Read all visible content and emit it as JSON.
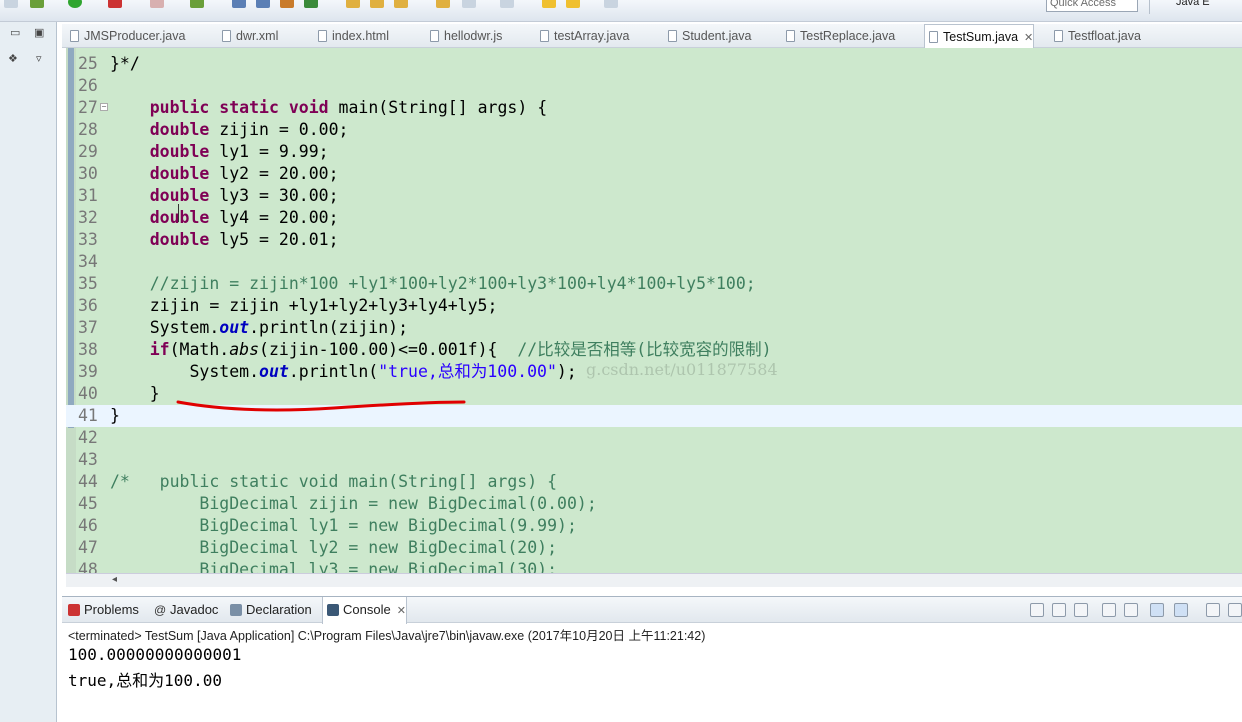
{
  "quick_access": "Quick Access",
  "perspective": "Java E",
  "editor_tabs": [
    "JMSProducer.java",
    "dwr.xml",
    "index.html",
    "hellodwr.js",
    "testArray.java",
    "Student.java",
    "TestReplace.java",
    "TestSum.java",
    "Testfloat.java"
  ],
  "active_tab_close": "✕",
  "code_lines": [
    {
      "n": "25",
      "html": "}*/"
    },
    {
      "n": "26",
      "html": ""
    },
    {
      "n": "27",
      "html": "    <span class=\"k\">public</span> <span class=\"k\">static</span> <span class=\"k\">void</span> main(String[] args) {"
    },
    {
      "n": "28",
      "html": "    <span class=\"k\">double</span> zijin = 0.00;"
    },
    {
      "n": "29",
      "html": "    <span class=\"k\">double</span> ly1 = 9.99;"
    },
    {
      "n": "30",
      "html": "    <span class=\"k\">double</span> ly2 = 20.00;"
    },
    {
      "n": "31",
      "html": "    <span class=\"k\">double</span> ly3 = 30.00;"
    },
    {
      "n": "32",
      "html": "    <span class=\"k\">double</span> ly4 = 20.00;"
    },
    {
      "n": "33",
      "html": "    <span class=\"k\">double</span> ly5 = 20.01;"
    },
    {
      "n": "34",
      "html": ""
    },
    {
      "n": "35",
      "html": "    <span class=\"cm\">//zijin = zijin*100 +ly1*100+ly2*100+ly3*100+ly4*100+ly5*100;</span>"
    },
    {
      "n": "36",
      "html": "    zijin = zijin +ly1+ly2+ly3+ly4+ly5;"
    },
    {
      "n": "37",
      "html": "    System.<span class=\"fld\">out</span>.println(zijin);"
    },
    {
      "n": "38",
      "html": "    <span class=\"k\">if</span>(Math.<span class=\"it\">abs</span>(zijin-100.00)<=0.001f){  <span class=\"cm\">//比较是否相等(比较宽容的限制)</span>"
    },
    {
      "n": "39",
      "html": "        System.<span class=\"fld\">out</span>.println(<span class=\"st\">\"true,总和为100.00\"</span>);"
    },
    {
      "n": "40",
      "html": "    }"
    },
    {
      "n": "41",
      "html": "}"
    },
    {
      "n": "42",
      "html": ""
    },
    {
      "n": "43",
      "html": ""
    },
    {
      "n": "44",
      "html": "<span class=\"cm\">/*   public static void main(String[] args) {</span>"
    },
    {
      "n": "45",
      "html": "<span class=\"cm\">         BigDecimal zijin = new BigDecimal(0.00);</span>"
    },
    {
      "n": "46",
      "html": "<span class=\"cm\">         BigDecimal ly1 = new BigDecimal(9.99);</span>"
    },
    {
      "n": "47",
      "html": "<span class=\"cm\">         BigDecimal ly2 = new BigDecimal(20);</span>"
    },
    {
      "n": "48",
      "html": "<span class=\"cm\">         BigDecimal ly3 = new BigDecimal(30);</span>"
    }
  ],
  "watermark": "g.csdn.net/u011877584",
  "bottom_tabs": [
    "Problems",
    "Javadoc",
    "Declaration",
    "Console"
  ],
  "console": {
    "terminated": "<terminated> TestSum [Java Application] C:\\Program Files\\Java\\jre7\\bin\\javaw.exe (2017年10月20日 上午11:21:42)",
    "line1": "100.00000000000001",
    "line2": "true,总和为100.00"
  }
}
